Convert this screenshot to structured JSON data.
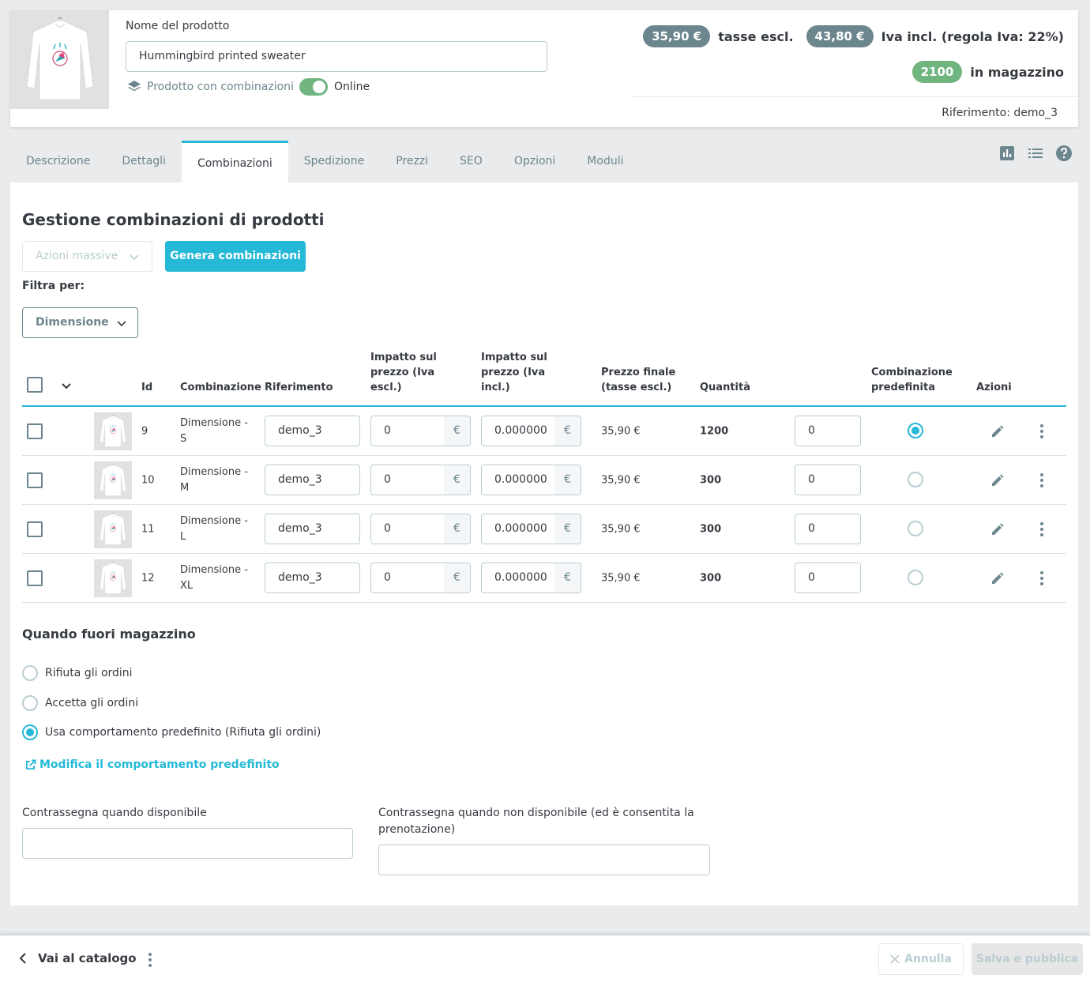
{
  "header": {
    "product_name_label": "Nome del prodotto",
    "product_name_value": "Hummingbird printed sweater",
    "combinations_link": "Prodotto con combinazioni",
    "online_label": "Online",
    "online_enabled": true,
    "price_excl": "35,90 €",
    "price_excl_label": "tasse escl.",
    "price_incl": "43,80 €",
    "price_incl_label": "Iva incl. (regola Iva: 22%)",
    "stock_qty": "2100",
    "stock_label": "in magazzino",
    "reference": "Riferimento: demo_3"
  },
  "tabs": [
    {
      "label": "Descrizione",
      "active": false
    },
    {
      "label": "Dettagli",
      "active": false
    },
    {
      "label": "Combinazioni",
      "active": true
    },
    {
      "label": "Spedizione",
      "active": false
    },
    {
      "label": "Prezzi",
      "active": false
    },
    {
      "label": "SEO",
      "active": false
    },
    {
      "label": "Opzioni",
      "active": false
    },
    {
      "label": "Moduli",
      "active": false
    }
  ],
  "main": {
    "title": "Gestione combinazioni di prodotti",
    "bulk_actions": "Azioni massive",
    "generate_button": "Genera combinazioni",
    "filter_label": "Filtra per:",
    "filter_value": "Dimensione"
  },
  "table": {
    "headers": {
      "id": "Id",
      "combination": "Combinazione",
      "reference": "Riferimento",
      "impact_excl": "Impatto sul prezzo (Iva escl.)",
      "impact_incl": "Impatto sul prezzo (Iva incl.)",
      "final_price": "Prezzo finale (tasse escl.)",
      "quantity": "Quantità",
      "default": "Combinazione predefinita",
      "actions": "Azioni"
    },
    "currency": "€",
    "rows": [
      {
        "id": "9",
        "combination": "Dimensione - S",
        "reference": "demo_3",
        "impact_excl": "0",
        "impact_incl": "0.000000",
        "final_price": "35,90 €",
        "stock": "1200",
        "quantity": "0",
        "default": true
      },
      {
        "id": "10",
        "combination": "Dimensione - M",
        "reference": "demo_3",
        "impact_excl": "0",
        "impact_incl": "0.000000",
        "final_price": "35,90 €",
        "stock": "300",
        "quantity": "0",
        "default": false
      },
      {
        "id": "11",
        "combination": "Dimensione - L",
        "reference": "demo_3",
        "impact_excl": "0",
        "impact_incl": "0.000000",
        "final_price": "35,90 €",
        "stock": "300",
        "quantity": "0",
        "default": false
      },
      {
        "id": "12",
        "combination": "Dimensione - XL",
        "reference": "demo_3",
        "impact_excl": "0",
        "impact_incl": "0.000000",
        "final_price": "35,90 €",
        "stock": "300",
        "quantity": "0",
        "default": false
      }
    ]
  },
  "out_of_stock": {
    "title": "Quando fuori magazzino",
    "options": [
      {
        "label": "Rifiuta gli ordini",
        "selected": false
      },
      {
        "label": "Accetta gli ordini",
        "selected": false
      },
      {
        "label": "Usa comportamento predefinito (Rifiuta gli ordini)",
        "selected": true
      }
    ],
    "edit_link": "Modifica il comportamento predefinito",
    "label_available": "Contrassegna quando disponibile",
    "label_unavailable": "Contrassegna quando non disponibile (ed è consentita la prenotazione)",
    "value_available": "",
    "value_unavailable": ""
  },
  "footer": {
    "back_label": "Vai al catalogo",
    "cancel_label": "Annulla",
    "save_label": "Salva e pubblica"
  },
  "colors": {
    "accent": "#25b9d7",
    "success": "#70b580",
    "muted": "#6c868e"
  }
}
